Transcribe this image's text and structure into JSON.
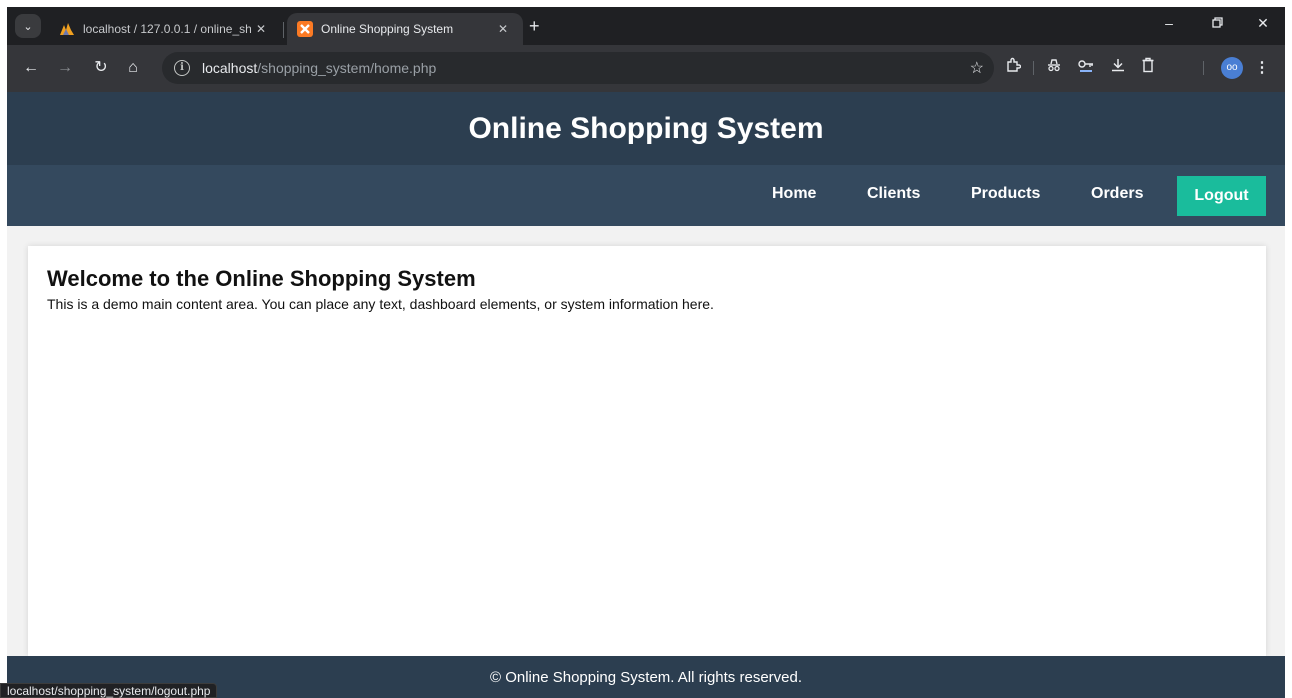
{
  "browser": {
    "tabs": [
      {
        "title": "localhost / 127.0.0.1 / online_sh",
        "favicon": "phpmyadmin-icon",
        "active": false
      },
      {
        "title": "Online Shopping System",
        "favicon": "xampp-icon",
        "active": true
      }
    ],
    "close_glyph": "✕",
    "new_tab_glyph": "+",
    "address": {
      "host": "localhost",
      "path": "/shopping_system/home.php"
    },
    "status_url": "localhost/shopping_system/logout.php",
    "profile_initial": "oo"
  },
  "site": {
    "title": "Online Shopping System",
    "nav": [
      "Home",
      "Clients",
      "Products",
      "Orders"
    ],
    "logout_label": "Logout",
    "welcome_heading": "Welcome to the Online Shopping System",
    "welcome_text": "This is a demo main content area. You can place any text, dashboard elements, or system information here.",
    "footer": "© Online Shopping System. All rights reserved.",
    "colors": {
      "header": "#2c3e50",
      "nav": "#34495e",
      "logout": "#1abc9c",
      "background": "#f2f2f2"
    }
  }
}
